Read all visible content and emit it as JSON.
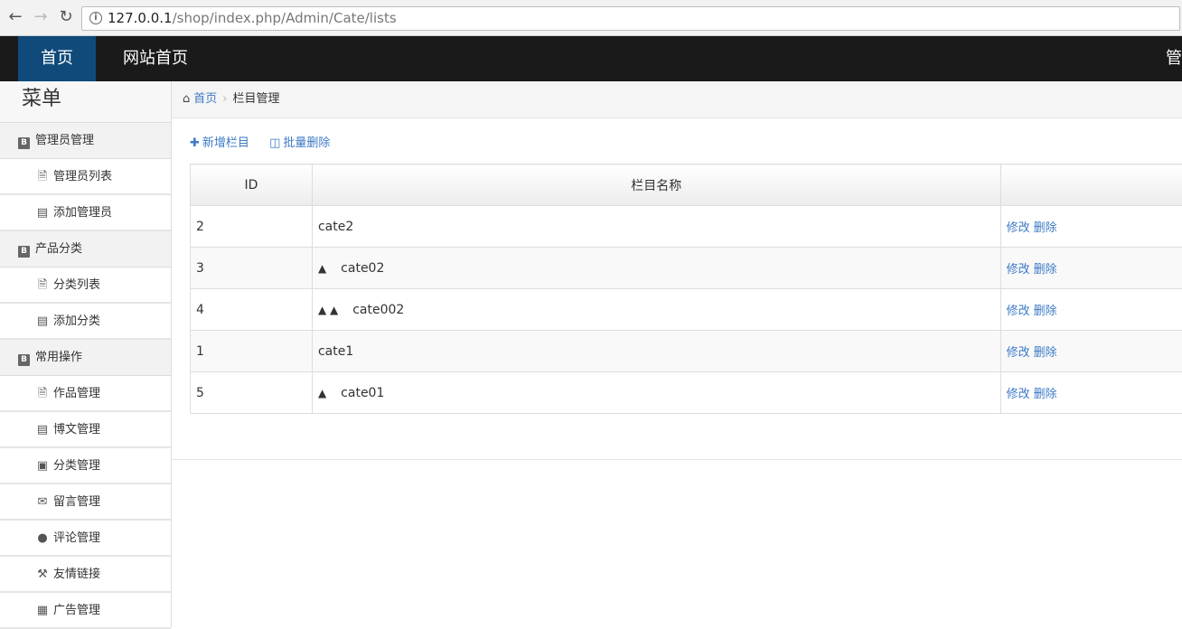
{
  "browser": {
    "url_host": "127.0.0.1",
    "url_path": "/shop/index.php/Admin/Cate/lists"
  },
  "topnav": {
    "home": "首页",
    "site_home": "网站首页",
    "right_label": "管"
  },
  "sidebar": {
    "title": "菜单",
    "groups": [
      {
        "label": "管理员管理",
        "items": [
          {
            "label": "管理员列表",
            "icon": "file-icon"
          },
          {
            "label": "添加管理员",
            "icon": "list-icon"
          }
        ]
      },
      {
        "label": "产品分类",
        "items": [
          {
            "label": "分类列表",
            "icon": "file-icon"
          },
          {
            "label": "添加分类",
            "icon": "list-icon"
          }
        ]
      },
      {
        "label": "常用操作",
        "items": [
          {
            "label": "作品管理",
            "icon": "file-icon"
          },
          {
            "label": "博文管理",
            "icon": "list-icon"
          },
          {
            "label": "分类管理",
            "icon": "books-icon"
          },
          {
            "label": "留言管理",
            "icon": "envelope-icon"
          },
          {
            "label": "评论管理",
            "icon": "comment-icon"
          },
          {
            "label": "友情链接",
            "icon": "wrench-icon"
          },
          {
            "label": "广告管理",
            "icon": "picture-icon"
          }
        ]
      }
    ]
  },
  "breadcrumb": {
    "home": "首页",
    "current": "栏目管理"
  },
  "toolbar": {
    "add": "新增栏目",
    "batch_delete": "批量删除"
  },
  "table": {
    "headers": {
      "id": "ID",
      "name": "栏目名称",
      "op": ""
    },
    "edit_label": "修改",
    "delete_label": "删除",
    "rows": [
      {
        "id": "2",
        "prefix": "",
        "name": "cate2"
      },
      {
        "id": "3",
        "prefix": "▲",
        "name": "cate02"
      },
      {
        "id": "4",
        "prefix": "▲ ▲",
        "name": "cate002"
      },
      {
        "id": "1",
        "prefix": "",
        "name": "cate1"
      },
      {
        "id": "5",
        "prefix": "▲",
        "name": "cate01"
      }
    ]
  }
}
